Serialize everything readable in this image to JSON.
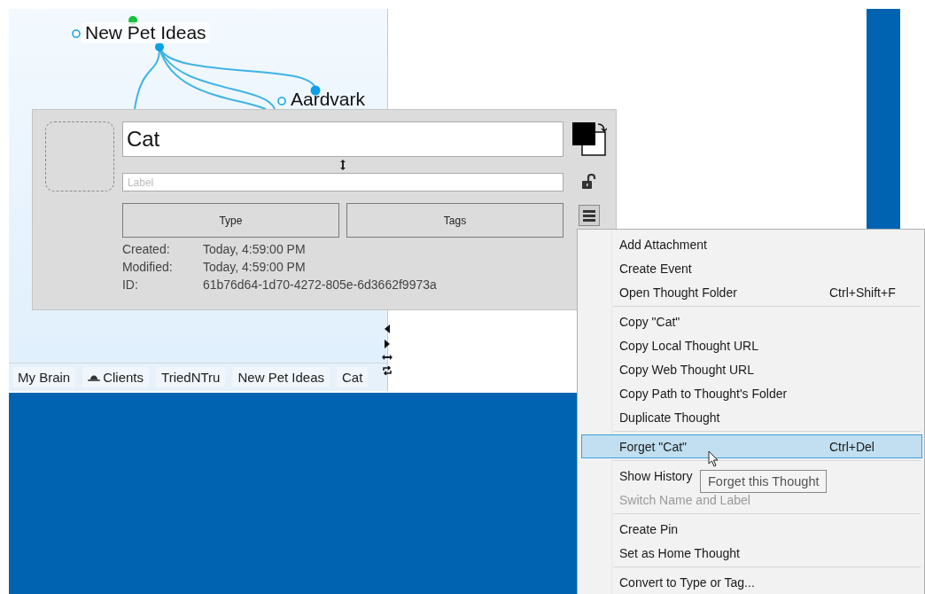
{
  "mind_map": {
    "nodes": [
      {
        "label": "New Pet Ideas"
      },
      {
        "label": "Aardvark"
      }
    ]
  },
  "breadcrumbs": [
    {
      "label": "My Brain",
      "kind": "plain"
    },
    {
      "label": "Clients",
      "kind": "with-icon"
    },
    {
      "label": "TriedNTru",
      "kind": "plain"
    },
    {
      "label": "New Pet Ideas",
      "kind": "plain"
    },
    {
      "label": "Cat",
      "kind": "plain"
    }
  ],
  "editor": {
    "name": "Cat",
    "label_field": {
      "placeholder": "Label"
    },
    "buttons": [
      "Type",
      "Tags"
    ],
    "details": [
      {
        "label": "Created:",
        "value": "Today, 4:59:00 PM"
      },
      {
        "label": "Modified:",
        "value": "Today, 4:59:00 PM"
      },
      {
        "label": "ID:",
        "value": "61b76d64-1d70-4272-805e-6d3662f9973a"
      }
    ]
  },
  "context_menu": {
    "items": [
      {
        "kind": "item",
        "label": "Add Attachment",
        "selected": false,
        "disabled": false
      },
      {
        "kind": "item",
        "label": "Create Event",
        "selected": false,
        "disabled": false
      },
      {
        "kind": "item",
        "label": "Open Thought Folder",
        "shortcut": "Ctrl+Shift+F",
        "selected": false,
        "disabled": false
      },
      {
        "kind": "separator"
      },
      {
        "kind": "item",
        "label": "Copy \"Cat\"",
        "selected": false,
        "disabled": false
      },
      {
        "kind": "item",
        "label": "Copy Local Thought URL",
        "selected": false,
        "disabled": false
      },
      {
        "kind": "item",
        "label": "Copy Web Thought URL",
        "selected": false,
        "disabled": false
      },
      {
        "kind": "item",
        "label": "Copy Path to Thought's Folder",
        "selected": false,
        "disabled": false
      },
      {
        "kind": "item",
        "label": "Duplicate Thought",
        "selected": false,
        "disabled": false
      },
      {
        "kind": "separator"
      },
      {
        "kind": "item",
        "label": "Forget \"Cat\"",
        "shortcut": "Ctrl+Del",
        "selected": true,
        "disabled": false
      },
      {
        "kind": "separator"
      },
      {
        "kind": "item",
        "label": "Show History",
        "selected": false,
        "disabled": false
      },
      {
        "kind": "item",
        "label": "Switch Name and Label",
        "selected": false,
        "disabled": true
      },
      {
        "kind": "separator"
      },
      {
        "kind": "item",
        "label": "Create Pin",
        "selected": false,
        "disabled": false
      },
      {
        "kind": "item",
        "label": "Set as Home Thought",
        "selected": false,
        "disabled": false
      },
      {
        "kind": "separator"
      },
      {
        "kind": "item",
        "label": "Convert to Type or Tag...",
        "selected": false,
        "disabled": false
      }
    ]
  },
  "tooltip": {
    "text": "Forget this Thought"
  }
}
